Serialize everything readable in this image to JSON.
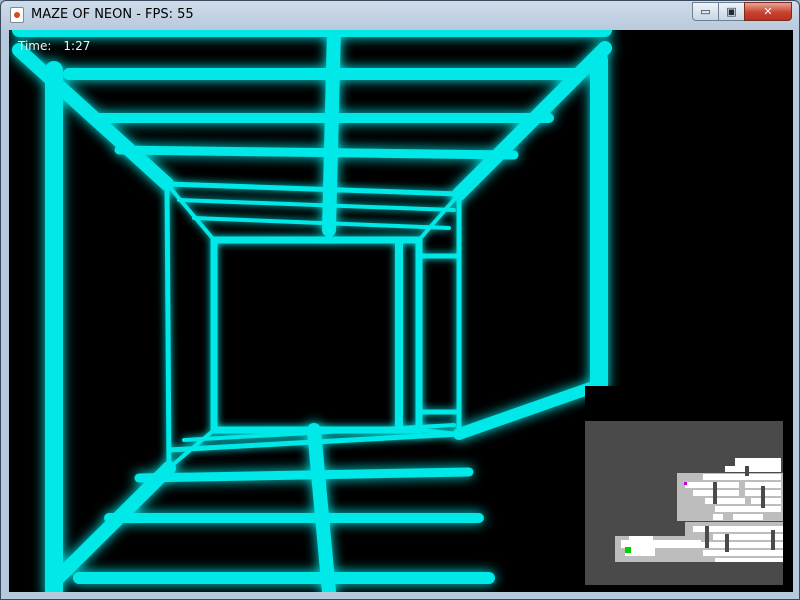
{
  "window": {
    "title": "MAZE OF NEON - FPS: 55",
    "minimize_symbol": "▭",
    "maximize_symbol": "▣",
    "close_symbol": "✕",
    "app_icon": "java-cup-icon"
  },
  "hud": {
    "time_label": "Time:",
    "time_value": "1:27"
  },
  "colors": {
    "neon": "#00e8e8",
    "background": "#000000",
    "minimap_floor": "#4a4a4a",
    "minimap_path": "#ffffff",
    "minimap_wall": "#bdbdbd",
    "player": "#00d200",
    "goal": "#c800c8"
  },
  "minimap": {
    "player_marker": "green-square",
    "goal_marker": "magenta-square"
  }
}
